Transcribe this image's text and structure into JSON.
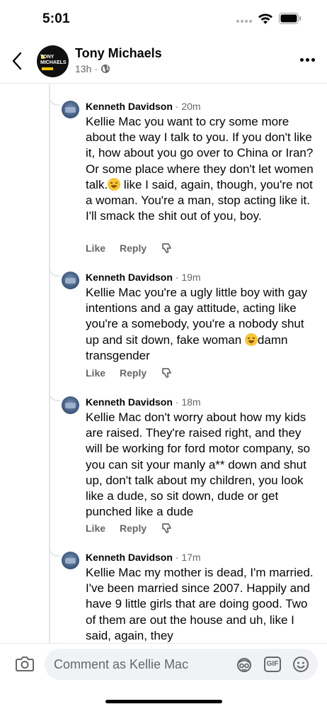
{
  "status_bar": {
    "time": "5:01",
    "icons": [
      "signal-dots-icon",
      "wifi-icon",
      "battery-icon"
    ]
  },
  "header": {
    "back_icon": "chevron-left-icon",
    "page_name": "Tony Michaels",
    "post_age": "13h",
    "separator": "·",
    "audience_icon": "globe-icon",
    "logo_text": "TONY MICHAELS",
    "more_icon": "more-horizontal-icon"
  },
  "comments": [
    {
      "author": "Kenneth Davidson",
      "time": "· 20m",
      "text_before": "Kellie Mac you want to cry some more about the way I talk to you. If you don't like it, how about you go over to China or Iran? Or some place where they don't let women talk.",
      "emoji": "face-with-hand-over-mouth-emoji",
      "text_after": " like I said, again, though, you're not a woman. You're a man, stop acting like it. I'll smack the shit out of you, boy.",
      "like": "Like",
      "reply": "Reply"
    },
    {
      "author": "Kenneth Davidson",
      "time": "· 19m",
      "text_before": "Kellie Mac you're a ugly little boy with gay intentions and a gay attitude, acting like you're a somebody, you're a nobody shut up and sit down, fake woman ",
      "emoji": "rolling-on-floor-laughing-emoji",
      "text_after": "damn transgender",
      "like": "Like",
      "reply": "Reply"
    },
    {
      "author": "Kenneth Davidson",
      "time": "· 18m",
      "text_before": "Kellie Mac don't worry about how my kids are raised. They're raised right, and they will be working for ford motor company, so you can sit your manly a** down and shut up, don't talk about my children, you look like a dude, so sit down, dude or get punched like a dude",
      "emoji": "",
      "text_after": "",
      "like": "Like",
      "reply": "Reply"
    },
    {
      "author": "Kenneth Davidson",
      "time": "· 17m",
      "text_before": "Kellie Mac my mother is dead, I'm married. I've been married since 2007. Happily and have 9 little girls that are doing good. Two of them are out the house and uh, like I said, again, they",
      "emoji": "",
      "text_after": "",
      "like": "",
      "reply": ""
    }
  ],
  "composer": {
    "camera_icon": "camera-icon",
    "placeholder": "Comment as Kellie Mac",
    "avatar_sticker_icon": "avatar-sticker-icon",
    "gif_label": "GIF",
    "emoji_icon": "smiley-icon"
  },
  "colors": {
    "text": "#050505",
    "secondary": "#65676b",
    "divider": "#e4e6eb",
    "input_bg": "#f0f2f5"
  }
}
